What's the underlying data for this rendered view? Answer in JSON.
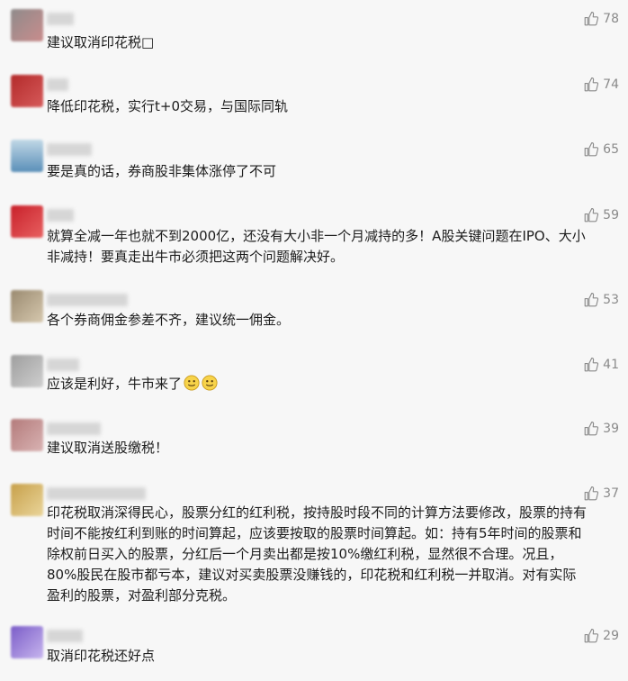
{
  "comments": [
    {
      "text": "建议取消印花税□",
      "likes": "78",
      "avatar_colors": [
        "#8f8b8b",
        "#c98c8c"
      ]
    },
    {
      "text": "降低印花税，实行t+0交易，与国际同轨",
      "likes": "74",
      "avatar_colors": [
        "#b32a2a",
        "#d65a5a"
      ]
    },
    {
      "text": "要是真的话，券商股非集体涨停了不可",
      "likes": "65",
      "avatar_colors": [
        "#5a8fb8",
        "#c1d8e6"
      ]
    },
    {
      "text": "就算全减一年也就不到2000亿，还没有大小非一个月减持的多！A股关键问题在IPO、大小非减持！要真走出牛市必须把这两个问题解决好。",
      "likes": "59",
      "avatar_colors": [
        "#c8202a",
        "#e86060"
      ]
    },
    {
      "text": "各个券商佣金参差不齐，建议统一佣金。",
      "likes": "53",
      "avatar_colors": [
        "#9a8a70",
        "#d6c8ae"
      ]
    },
    {
      "text": "应该是利好，牛市来了",
      "likes": "41",
      "avatar_colors": [
        "#9e9e9e",
        "#cfcfcf"
      ],
      "emoji": "smiling-face-emoji"
    },
    {
      "text": "建议取消送股缴税！",
      "likes": "39",
      "avatar_colors": [
        "#b37a7a",
        "#d9b3b3"
      ]
    },
    {
      "text": "印花税取消深得民心，股票分红的红利税，按持股时段不同的计算方法要修改，股票的持有时间不能按红利到账的时间算起，应该要按取的股票时间算起。如：持有5年时间的股票和除权前日买入的股票，分红后一个月卖出都是按10%缴红利税，显然很不合理。况且，80%股民在股市都亏本，建议对买卖股票没赚钱的，印花税和红利税一并取消。对有实际盈利的股票，对盈利部分克税。",
      "likes": "37",
      "avatar_colors": [
        "#c7a04a",
        "#ead59a"
      ]
    },
    {
      "text": "取消印花税还好点",
      "likes": "29",
      "avatar_colors": [
        "#7a5cc8",
        "#c7b5ee"
      ]
    }
  ]
}
